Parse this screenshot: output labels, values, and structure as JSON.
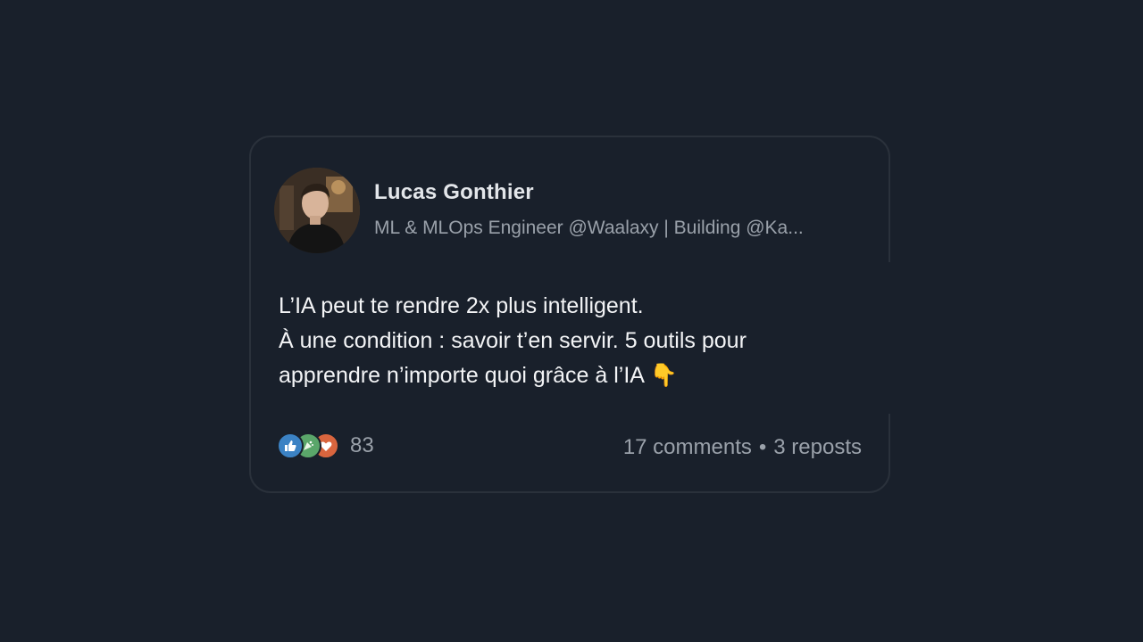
{
  "post": {
    "author": "Lucas Gonthier",
    "headline": "ML & MLOps Engineer @Waalaxy | Building @Ka...",
    "avatar_icon": "profile-photo",
    "body_lines": [
      "L’IA peut te rendre 2x plus intelligent.",
      "À une condition : savoir t’en servir. 5 outils pour",
      "apprendre n’importe quoi grâce à l’IA"
    ],
    "emoji": "👇",
    "reactions": {
      "icons": [
        "like-icon",
        "celebrate-icon",
        "love-icon"
      ],
      "count": "83"
    },
    "comments": "17 comments",
    "separator": "•",
    "reposts": "3 reposts"
  },
  "colors": {
    "background": "#19202b",
    "card_border": "#2a313b",
    "text_primary": "#f3f4f6",
    "text_secondary": "#9aa1aa"
  }
}
